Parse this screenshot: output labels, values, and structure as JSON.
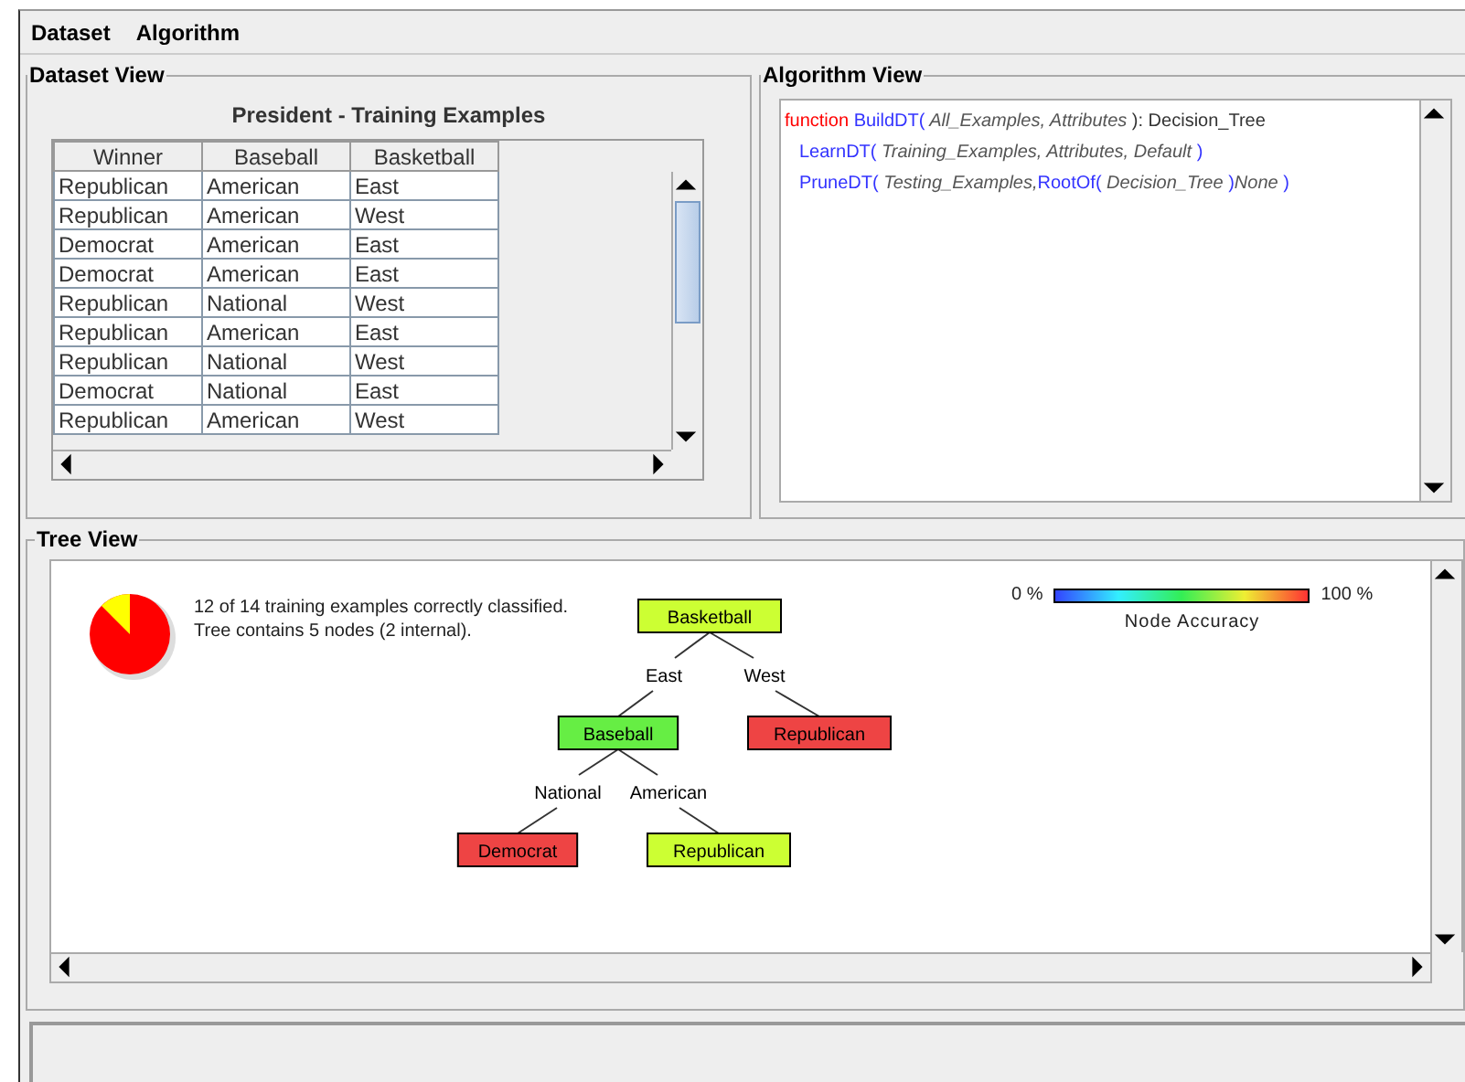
{
  "menu": [
    {
      "label": "Dataset"
    },
    {
      "label": "Algorithm"
    }
  ],
  "dataset_view": {
    "title": "Dataset View",
    "table_title": "President - Training Examples",
    "columns": [
      "Winner",
      "Baseball",
      "Basketball"
    ],
    "rows": [
      [
        "Republican",
        "American",
        "East"
      ],
      [
        "Republican",
        "American",
        "West"
      ],
      [
        "Democrat",
        "American",
        "East"
      ],
      [
        "Democrat",
        "American",
        "East"
      ],
      [
        "Republican",
        "National",
        "West"
      ],
      [
        "Republican",
        "American",
        "East"
      ],
      [
        "Republican",
        "National",
        "West"
      ],
      [
        "Democrat",
        "National",
        "East"
      ],
      [
        "Republican",
        "American",
        "West"
      ]
    ]
  },
  "algorithm_view": {
    "title": "Algorithm View",
    "lines": [
      [
        {
          "kind": "keyword",
          "text": "function "
        },
        {
          "kind": "call",
          "text": "BuildDT("
        },
        {
          "kind": "param",
          "text": " All_Examples, Attributes "
        },
        {
          "kind": "plain",
          "text": "): Decision_Tree"
        }
      ],
      [
        {
          "kind": "call",
          "text": "LearnDT("
        },
        {
          "kind": "param",
          "text": " Training_Examples, Attributes, Default "
        },
        {
          "kind": "call",
          "text": ")"
        }
      ],
      [
        {
          "kind": "call",
          "text": "PruneDT("
        },
        {
          "kind": "param",
          "text": " Testing_Examples,"
        },
        {
          "kind": "call",
          "text": "RootOf("
        },
        {
          "kind": "param",
          "text": " Decision_Tree "
        },
        {
          "kind": "call",
          "text": ")"
        },
        {
          "kind": "param",
          "text": "None "
        },
        {
          "kind": "call",
          "text": ")"
        }
      ]
    ]
  },
  "tree_view": {
    "title": "Tree View",
    "summary": [
      "12 of 14 training examples correctly classified.",
      "Tree contains 5 nodes (2 internal)."
    ],
    "legend": {
      "min": "0 %",
      "max": "100 %",
      "label": "Node Accuracy"
    },
    "tree": {
      "label": "Basketball",
      "color": "#ccff33",
      "children": [
        {
          "edge": "East",
          "label": "Baseball",
          "color": "#66ee44",
          "children": [
            {
              "edge": "National",
              "label": "Democrat",
              "color": "#ee4444"
            },
            {
              "edge": "American",
              "label": "Republican",
              "color": "#ccff33"
            }
          ]
        },
        {
          "edge": "West",
          "label": "Republican",
          "color": "#ee4444"
        }
      ]
    }
  }
}
